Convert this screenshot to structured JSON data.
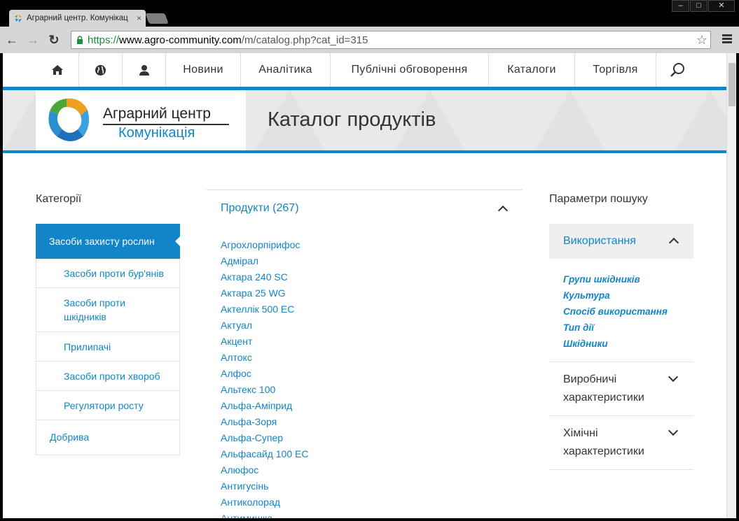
{
  "browser": {
    "tab_title": "Аграрний центр. Комунікац",
    "tab_close": "×",
    "url_scheme": "https://",
    "url_host": "www.agro-community.com",
    "url_path": "/m/catalog.php?cat_id=315"
  },
  "site_nav": {
    "items": [
      "Новини",
      "Аналітика",
      "Публічні обговорення",
      "Каталоги",
      "Торгівля"
    ]
  },
  "logo": {
    "line1": "Аграрний центр",
    "line2": "Комунікація"
  },
  "banner_title": "Каталог продуктів",
  "categories": {
    "heading": "Категорії",
    "active": "Засоби захисту рослин",
    "subcategories": [
      "Засоби проти бур'янів",
      "Засоби проти шкідників",
      "Прилипачі",
      "Засоби проти хвороб",
      "Регулятори росту"
    ],
    "other": "Добрива"
  },
  "products": {
    "heading": "Продукти (267)",
    "items": [
      "Агрохлорпірифос",
      "Адмірал",
      "Актара 240 SC",
      "Актара 25 WG",
      "Актеллік 500 ЕС",
      "Актуал",
      "Акцент",
      "Алтокс",
      "Алфос",
      "Альтекс 100",
      "Альфа-Аміприд",
      "Альфа-Зоря",
      "Альфа-Супер",
      "Альфасайд 100 ЕС",
      "Алюфос",
      "Антигусінь",
      "Антиколорад",
      "Антимишка"
    ]
  },
  "search_params": {
    "heading": "Параметри пошуку",
    "usage": {
      "title": "Використання",
      "links": [
        "Групи шкідників",
        "Культура",
        "Спосіб використання",
        "Тип дії",
        "Шкідники"
      ]
    },
    "production": "Виробничі характеристики",
    "chemical": "Хімічні характеристики"
  },
  "colors": {
    "accent": "#1185c8",
    "text": "#333333"
  }
}
